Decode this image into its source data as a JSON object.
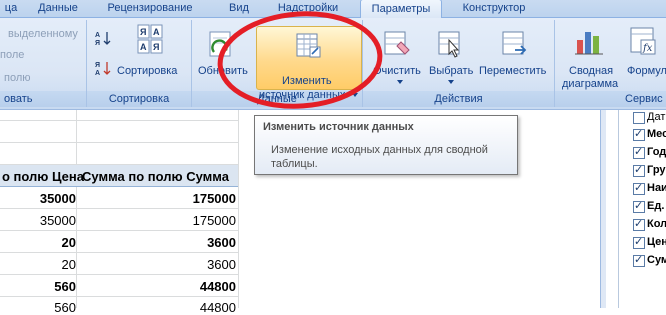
{
  "tabs": [
    {
      "label": "ца",
      "active": false
    },
    {
      "label": "Данные",
      "active": false
    },
    {
      "label": "Рецензирование",
      "active": false
    },
    {
      "label": "Вид",
      "active": false
    },
    {
      "label": "Надстройки",
      "active": false
    },
    {
      "label": "Параметры",
      "active": true
    },
    {
      "label": "Конструктор",
      "active": false
    }
  ],
  "ribbon": {
    "group_left": {
      "item1": "выделенному",
      "item2": "поле",
      "item3": "полю",
      "label": "овать"
    },
    "group_sort": {
      "sort_label": "Сортировка",
      "label": "Сортировка"
    },
    "group_data": {
      "refresh": "Обновить",
      "change_source_line1": "Изменить",
      "change_source_line2": "источник данных",
      "label": "Данные"
    },
    "group_actions": {
      "clear": "Очистить",
      "select": "Выбрать",
      "move": "Переместить",
      "label": "Действия"
    },
    "group_service": {
      "pivot_chart_line1": "Сводная",
      "pivot_chart_line2": "диаграмма",
      "formulas": "Формул",
      "label": "Сервис"
    }
  },
  "tooltip": {
    "title": "Изменить источник данных",
    "body": "Изменение исходных данных для сводной таблицы."
  },
  "table": {
    "headers": [
      "о полю Цена",
      "Сумма по полю Сумма"
    ],
    "rows": [
      {
        "price": "35000",
        "sum": "175000",
        "bold": true
      },
      {
        "price": "35000",
        "sum": "175000",
        "bold": false
      },
      {
        "price": "20",
        "sum": "3600",
        "bold": true
      },
      {
        "price": "20",
        "sum": "3600",
        "bold": false
      },
      {
        "price": "560",
        "sum": "44800",
        "bold": true
      },
      {
        "price": "560",
        "sum": "44800",
        "bold": false
      }
    ]
  },
  "field_list": [
    {
      "label": "Дат",
      "checked": false
    },
    {
      "label": "Мес",
      "checked": true
    },
    {
      "label": "Год",
      "checked": true
    },
    {
      "label": "Гру",
      "checked": true
    },
    {
      "label": "Наи",
      "checked": true
    },
    {
      "label": "Ед.",
      "checked": true
    },
    {
      "label": "Кол",
      "checked": true
    },
    {
      "label": "Цен",
      "checked": true
    },
    {
      "label": "Сум",
      "checked": true
    }
  ],
  "colors": {
    "annotation": "#e41e26",
    "highlight": "#ffd98c",
    "ribbon_text": "#15428b"
  }
}
